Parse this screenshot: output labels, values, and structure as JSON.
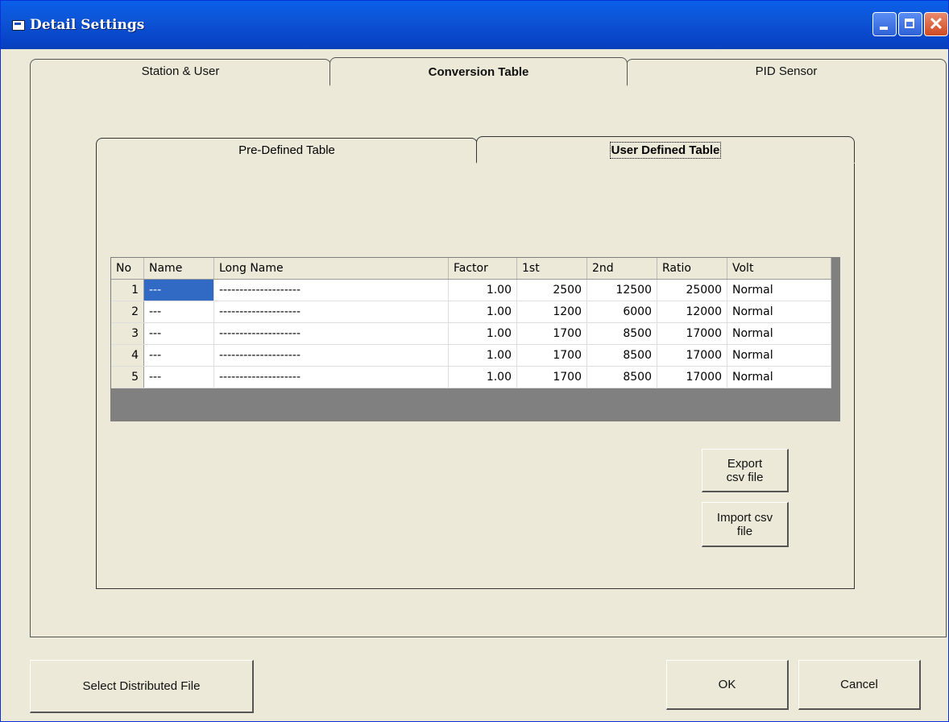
{
  "window": {
    "title": "Detail Settings"
  },
  "tabs": [
    "Station & User",
    "Conversion Table",
    "PID Sensor"
  ],
  "subtabs": [
    "Pre-Defined Table",
    "User Defined Table"
  ],
  "table": {
    "columns": [
      "No",
      "Name",
      "Long Name",
      "Factor",
      "1st",
      "2nd",
      "Ratio",
      "Volt"
    ],
    "rows": [
      [
        "1",
        "---",
        "--------------------",
        "1.00",
        "2500",
        "12500",
        "25000",
        "Normal"
      ],
      [
        "2",
        "---",
        "--------------------",
        "1.00",
        "1200",
        "6000",
        "12000",
        "Normal"
      ],
      [
        "3",
        "---",
        "--------------------",
        "1.00",
        "1700",
        "8500",
        "17000",
        "Normal"
      ],
      [
        "4",
        "---",
        "--------------------",
        "1.00",
        "1700",
        "8500",
        "17000",
        "Normal"
      ],
      [
        "5",
        "---",
        "--------------------",
        "1.00",
        "1700",
        "8500",
        "17000",
        "Normal"
      ]
    ]
  },
  "buttons": {
    "export_line1": "Export",
    "export_line2": "csv file",
    "import_line1": "Import csv",
    "import_line2": "file",
    "select_file": "Select Distributed File",
    "ok": "OK",
    "cancel": "Cancel"
  },
  "colors": {
    "titlebar": "#0A5FE8",
    "window_bg": "#ECE9D8",
    "selection": "#316AC5"
  }
}
